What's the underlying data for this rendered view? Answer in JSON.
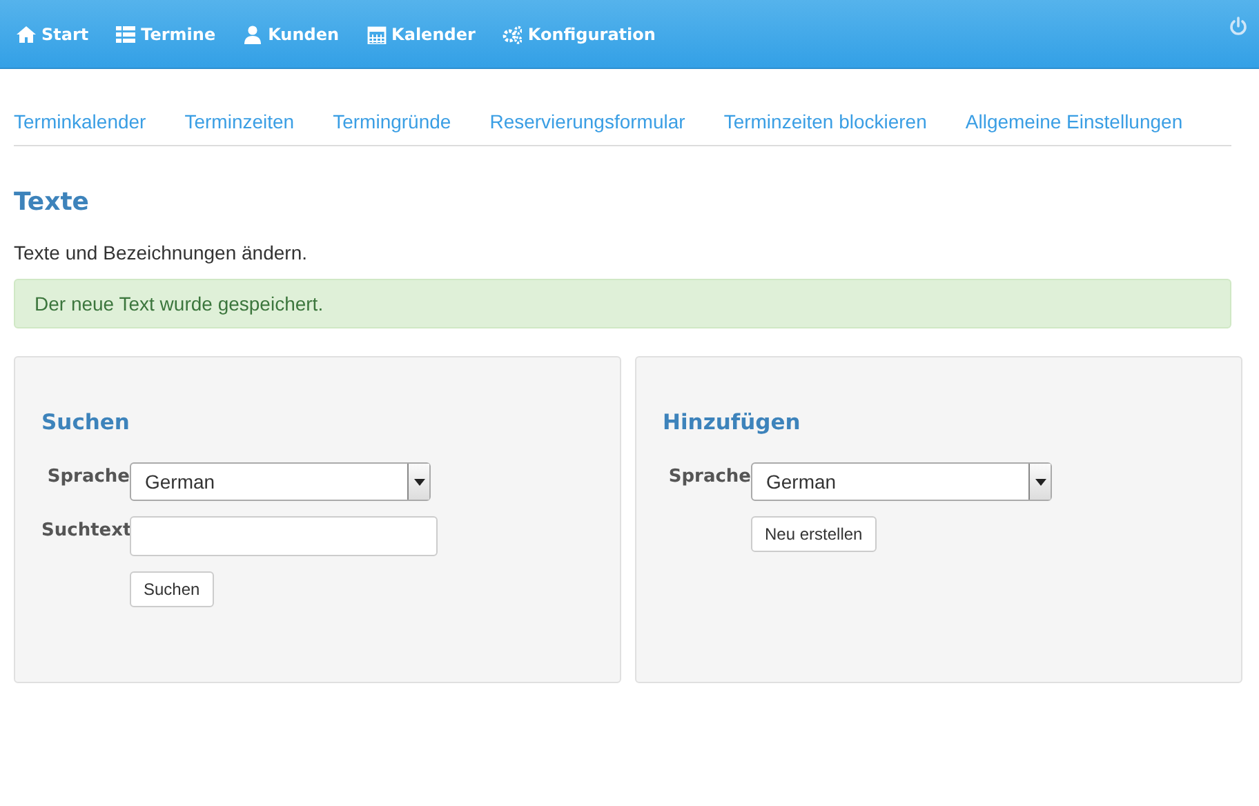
{
  "navbar": {
    "items": [
      {
        "label": "Start"
      },
      {
        "label": "Termine"
      },
      {
        "label": "Kunden"
      },
      {
        "label": "Kalender"
      },
      {
        "label": "Konfiguration"
      }
    ]
  },
  "subnav": [
    "Terminkalender",
    "Terminzeiten",
    "Termingründe",
    "Reservierungsformular",
    "Terminzeiten blockieren",
    "Allgemeine Einstellungen"
  ],
  "heading": "Texte",
  "description": "Texte und Bezeichnungen ändern.",
  "alert": "Der neue Text wurde gespeichert.",
  "panels": [
    {
      "title": "Suchen",
      "fields": [
        {
          "kind": "select",
          "label": "Sprache",
          "value": "German"
        },
        {
          "kind": "text",
          "label": "Suchtext"
        }
      ],
      "button": "Suchen"
    },
    {
      "title": "Hinzufügen",
      "fields": [
        {
          "kind": "select",
          "label": "Sprache",
          "value": "German"
        }
      ],
      "button": "Neu erstellen"
    }
  ]
}
